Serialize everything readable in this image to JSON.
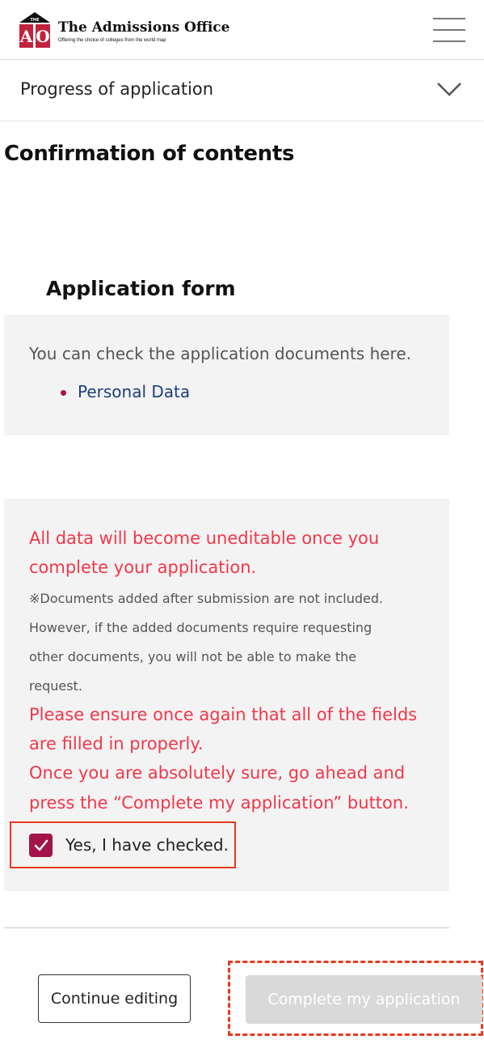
{
  "header": {
    "logo_badge_top": "THE",
    "logo_badge_letters": "AO",
    "title": "The Admissions Office",
    "tagline": "Offering the choice of colleges from the world map"
  },
  "progress": {
    "label": "Progress of application"
  },
  "page": {
    "title": "Confirmation of contents"
  },
  "application_form": {
    "title": "Application form",
    "description": "You can check the application documents here.",
    "links": [
      "Personal Data"
    ]
  },
  "notice": {
    "line1": "All data will become uneditable once you",
    "line2": "complete your application.",
    "note1": "※Documents added after submission are not included.",
    "note2": "However, if the added documents require requesting",
    "note3": "other documents, you will not be able to make the",
    "note4": "request.",
    "line3": "Please ensure once again that all of the fields",
    "line4": "are filled in properly.",
    "line5": "Once you are absolutely sure, go ahead and",
    "line6": "press the “Complete my application” button."
  },
  "confirmation": {
    "label": "Yes, I have checked.",
    "checked": true
  },
  "actions": {
    "continue_label": "Continue editing",
    "complete_label": "Complete my application"
  },
  "colors": {
    "accent": "#a3154a",
    "warning_text": "#f2374a",
    "link": "#1d3f77",
    "highlight": "#e8391f",
    "disabled_button": "#d9d9d9"
  }
}
